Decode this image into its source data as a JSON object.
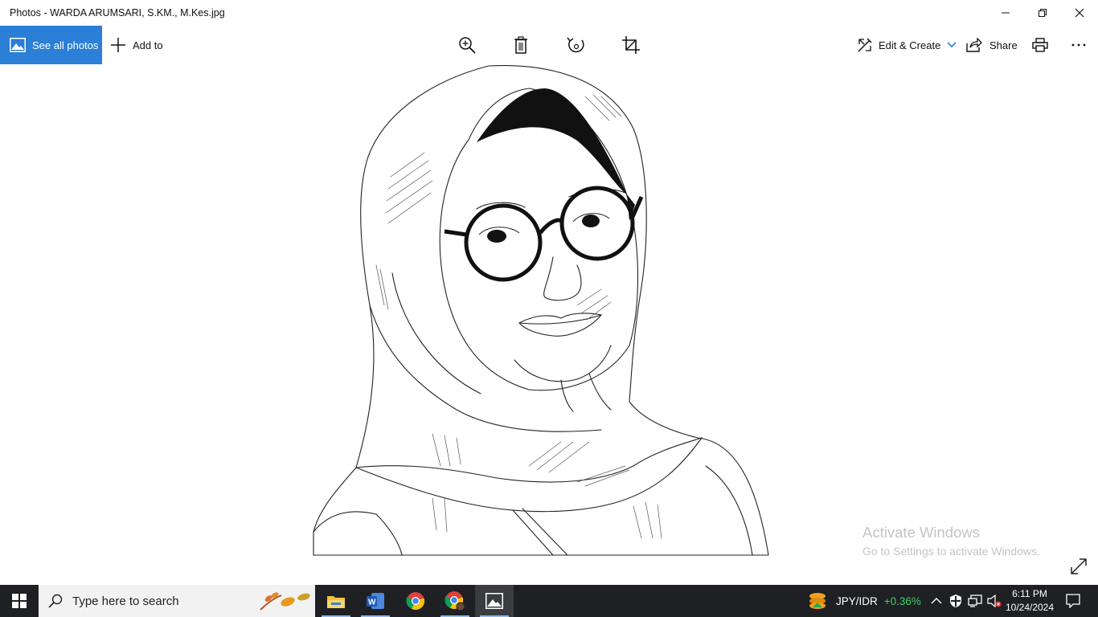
{
  "window": {
    "title": "Photos - WARDA ARUMSARI, S.KM., M.Kes.jpg"
  },
  "toolbar": {
    "see_all_photos": "See all photos",
    "add_to": "Add to",
    "edit_create": "Edit & Create",
    "share": "Share",
    "icons": [
      "zoom-icon",
      "delete-icon",
      "rotate-icon",
      "crop-icon",
      "print-icon",
      "more-icon"
    ]
  },
  "watermark": {
    "title": "Activate Windows",
    "subtitle": "Go to Settings to activate Windows."
  },
  "taskbar": {
    "search_placeholder": "Type here to search",
    "apps": [
      "file-explorer",
      "word",
      "chrome",
      "chrome-profile",
      "photos"
    ],
    "ticker": {
      "pair": "JPY/IDR",
      "change": "+0.36%",
      "change_color": "#3fcf6a"
    },
    "clock": {
      "time": "6:11 PM",
      "date": "10/24/2024"
    }
  },
  "colors": {
    "accent": "#2b7fd6",
    "taskbar_bg": "#1f2023"
  }
}
